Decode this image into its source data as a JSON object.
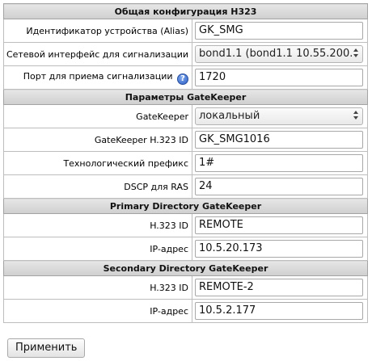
{
  "sections": {
    "general": {
      "title": "Общая конфигурация H323",
      "alias_label": "Идентификатор устройства (Alias)",
      "alias_value": "GK_SMG",
      "sig_if_label": "Сетевой интерфейс для сигнализации",
      "sig_if_value": "bond1.1 (bond1.1 10.55.200.",
      "sig_port_label": "Порт для приема сигнализации",
      "sig_port_help_icon": "question-icon",
      "sig_port_value": "1720"
    },
    "gatekeeper": {
      "title": "Параметры GateKeeper",
      "gk_label": "GateKeeper",
      "gk_value": "локальный",
      "gk_id_label": "GateKeeper H.323 ID",
      "gk_id_value": "GK_SMG1016",
      "prefix_label": "Технологический префикс",
      "prefix_value": "1#",
      "dscp_label": "DSCP для RAS",
      "dscp_value": "24"
    },
    "primary": {
      "title": "Primary Directory GateKeeper",
      "h323_label": "H.323 ID",
      "h323_value": "REMOTE",
      "ip_label": "IP-адрес",
      "ip_value": "10.5.20.173"
    },
    "secondary": {
      "title": "Secondary Directory GateKeeper",
      "h323_label": "H.323 ID",
      "h323_value": "REMOTE-2",
      "ip_label": "IP-адрес",
      "ip_value": "10.5.2.177"
    }
  },
  "apply_label": "Применить",
  "colors": {
    "section_bg": "#d6d6d6",
    "border": "#bdbdbd",
    "help_icon": "#2d5fc4"
  }
}
